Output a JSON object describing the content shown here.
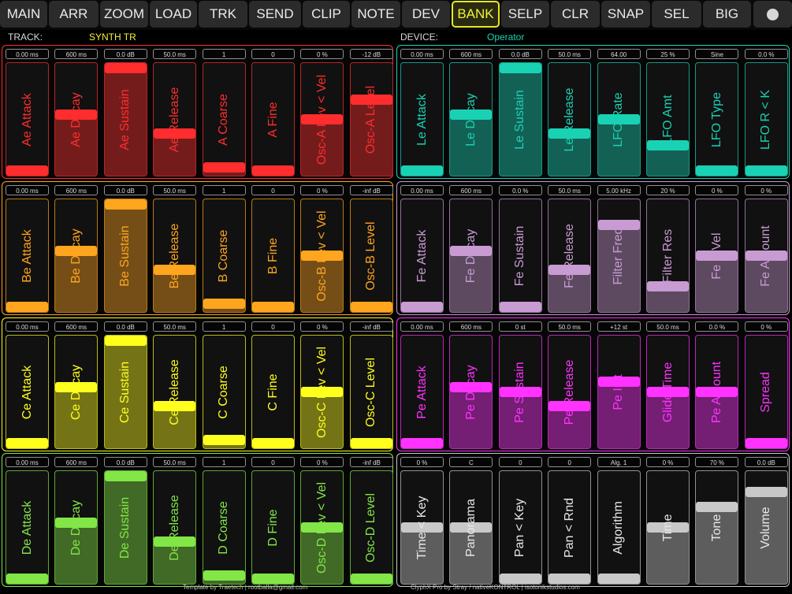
{
  "topbar": {
    "buttons": [
      {
        "label": "MAIN",
        "active": false
      },
      {
        "label": "ARR",
        "active": false
      },
      {
        "label": "ZOOM",
        "active": false
      },
      {
        "label": "LOAD",
        "active": false
      },
      {
        "label": "TRK",
        "active": false
      },
      {
        "label": "SEND",
        "active": false
      },
      {
        "label": "CLIP",
        "active": false
      },
      {
        "label": "NOTE",
        "active": false
      },
      {
        "label": "DEV",
        "active": false
      },
      {
        "label": "BANK",
        "active": true
      },
      {
        "label": "SELP",
        "active": false
      },
      {
        "label": "CLR",
        "active": false
      },
      {
        "label": "SNAP",
        "active": false
      },
      {
        "label": "SEL",
        "active": false
      },
      {
        "label": "BIG",
        "active": false
      }
    ],
    "dot_icon": "circle-dot-icon"
  },
  "header": {
    "track_label": "TRACK:",
    "track_name": "SYNTH TR",
    "device_label": "DEVICE:",
    "device_name": "Operator"
  },
  "banks": [
    {
      "id": "osc-a",
      "color": "#ff2d2d",
      "faders": [
        {
          "name": "Ae Attack",
          "value": "0.00 ms",
          "level": 0.0
        },
        {
          "name": "Ae Decay",
          "value": "600 ms",
          "level": 0.55
        },
        {
          "name": "Ae Sustain",
          "value": "0.0 dB",
          "level": 1.0
        },
        {
          "name": "Ae Release",
          "value": "50.0 ms",
          "level": 0.36
        },
        {
          "name": "A Coarse",
          "value": "1",
          "level": 0.03
        },
        {
          "name": "A Fine",
          "value": "0",
          "level": 0.0
        },
        {
          "name": "Osc-A Lev < Vel",
          "value": "0 %",
          "level": 0.5
        },
        {
          "name": "Osc-A Level",
          "value": "-12 dB",
          "level": 0.69
        }
      ]
    },
    {
      "id": "lfo",
      "color": "#19d2b4",
      "faders": [
        {
          "name": "Le Attack",
          "value": "0.00 ms",
          "level": 0.0
        },
        {
          "name": "Le Decay",
          "value": "600 ms",
          "level": 0.55
        },
        {
          "name": "Le Sustain",
          "value": "0.0 dB",
          "level": 1.0
        },
        {
          "name": "Le Release",
          "value": "50.0 ms",
          "level": 0.36
        },
        {
          "name": "LFO Rate",
          "value": "64.00",
          "level": 0.5
        },
        {
          "name": "LFO Amt",
          "value": "25 %",
          "level": 0.25
        },
        {
          "name": "LFO Type",
          "value": "Sine",
          "level": 0.0
        },
        {
          "name": "LFO R < K",
          "value": "0.0 %",
          "level": 0.0
        }
      ]
    },
    {
      "id": "osc-b",
      "color": "#ffa51e",
      "faders": [
        {
          "name": "Be Attack",
          "value": "0.00 ms",
          "level": 0.0
        },
        {
          "name": "Be Decay",
          "value": "600 ms",
          "level": 0.55
        },
        {
          "name": "Be Sustain",
          "value": "0.0 dB",
          "level": 1.0
        },
        {
          "name": "Be Release",
          "value": "50.0 ms",
          "level": 0.36
        },
        {
          "name": "B Coarse",
          "value": "1",
          "level": 0.03
        },
        {
          "name": "B Fine",
          "value": "0",
          "level": 0.0
        },
        {
          "name": "Osc-B Lev < Vel",
          "value": "0 %",
          "level": 0.5
        },
        {
          "name": "Osc-B Level",
          "value": "-inf dB",
          "level": 0.0
        }
      ]
    },
    {
      "id": "filter",
      "color": "#c89bd2",
      "faders": [
        {
          "name": "Fe Attack",
          "value": "0.00 ms",
          "level": 0.0
        },
        {
          "name": "Fe Decay",
          "value": "600 ms",
          "level": 0.55
        },
        {
          "name": "Fe Sustain",
          "value": "0.0 %",
          "level": 0.0
        },
        {
          "name": "Fe Release",
          "value": "50.0 ms",
          "level": 0.36
        },
        {
          "name": "Filter Freq",
          "value": "5.00 kHz",
          "level": 0.8
        },
        {
          "name": "Filter Res",
          "value": "20 %",
          "level": 0.2
        },
        {
          "name": "Fe < Vel",
          "value": "0 %",
          "level": 0.5
        },
        {
          "name": "Fe Amount",
          "value": "0 %",
          "level": 0.5
        }
      ]
    },
    {
      "id": "osc-c",
      "color": "#ffff1e",
      "faders": [
        {
          "name": "Ce Attack",
          "value": "0.00 ms",
          "level": 0.0
        },
        {
          "name": "Ce Decay",
          "value": "600 ms",
          "level": 0.55
        },
        {
          "name": "Ce Sustain",
          "value": "0.0 dB",
          "level": 1.0
        },
        {
          "name": "Ce Release",
          "value": "50.0 ms",
          "level": 0.36
        },
        {
          "name": "C Coarse",
          "value": "1",
          "level": 0.03
        },
        {
          "name": "C Fine",
          "value": "0",
          "level": 0.0
        },
        {
          "name": "Osc-C Lev < Vel",
          "value": "0 %",
          "level": 0.5
        },
        {
          "name": "Osc-C Level",
          "value": "-inf dB",
          "level": 0.0
        }
      ]
    },
    {
      "id": "pitch",
      "color": "#ff32ff",
      "faders": [
        {
          "name": "Pe Attack",
          "value": "0.00 ms",
          "level": 0.0
        },
        {
          "name": "Pe Decay",
          "value": "600 ms",
          "level": 0.55
        },
        {
          "name": "Pe Sustain",
          "value": "0 st",
          "level": 0.5
        },
        {
          "name": "Pe Release",
          "value": "50.0 ms",
          "level": 0.36
        },
        {
          "name": "Pe Init",
          "value": "+12 st",
          "level": 0.6
        },
        {
          "name": "Glide Time",
          "value": "50.0 ms",
          "level": 0.5
        },
        {
          "name": "Pe Amount",
          "value": "0.0 %",
          "level": 0.5
        },
        {
          "name": "Spread",
          "value": "0 %",
          "level": 0.0
        }
      ]
    },
    {
      "id": "osc-d",
      "color": "#82e646",
      "faders": [
        {
          "name": "De Attack",
          "value": "0.00 ms",
          "level": 0.0
        },
        {
          "name": "De Decay",
          "value": "600 ms",
          "level": 0.55
        },
        {
          "name": "De Sustain",
          "value": "0.0 dB",
          "level": 1.0
        },
        {
          "name": "De Release",
          "value": "50.0 ms",
          "level": 0.36
        },
        {
          "name": "D Coarse",
          "value": "1",
          "level": 0.03
        },
        {
          "name": "D Fine",
          "value": "0",
          "level": 0.0
        },
        {
          "name": "Osc-D Lev < Vel",
          "value": "0 %",
          "level": 0.5
        },
        {
          "name": "Osc-D Level",
          "value": "-inf dB",
          "level": 0.0
        }
      ]
    },
    {
      "id": "global",
      "color": "#c8c8c8",
      "faders": [
        {
          "name": "Time < Key",
          "value": "0 %",
          "level": 0.5
        },
        {
          "name": "Panorama",
          "value": "C",
          "level": 0.5
        },
        {
          "name": "Pan < Key",
          "value": "0",
          "level": 0.0
        },
        {
          "name": "Pan < Rnd",
          "value": "0",
          "level": 0.0
        },
        {
          "name": "Algorithm",
          "value": "Alg. 1",
          "level": 0.0
        },
        {
          "name": "Time",
          "value": "0 %",
          "level": 0.5
        },
        {
          "name": "Tone",
          "value": "70 %",
          "level": 0.7
        },
        {
          "name": "Volume",
          "value": "0.0 dB",
          "level": 0.85
        }
      ]
    }
  ],
  "footer": {
    "left": "Template by Traetech | rootballa@gmail.com",
    "right": "ClyphX Pro by Stray / nativeKONTROL |    isotonikstudios.com"
  }
}
